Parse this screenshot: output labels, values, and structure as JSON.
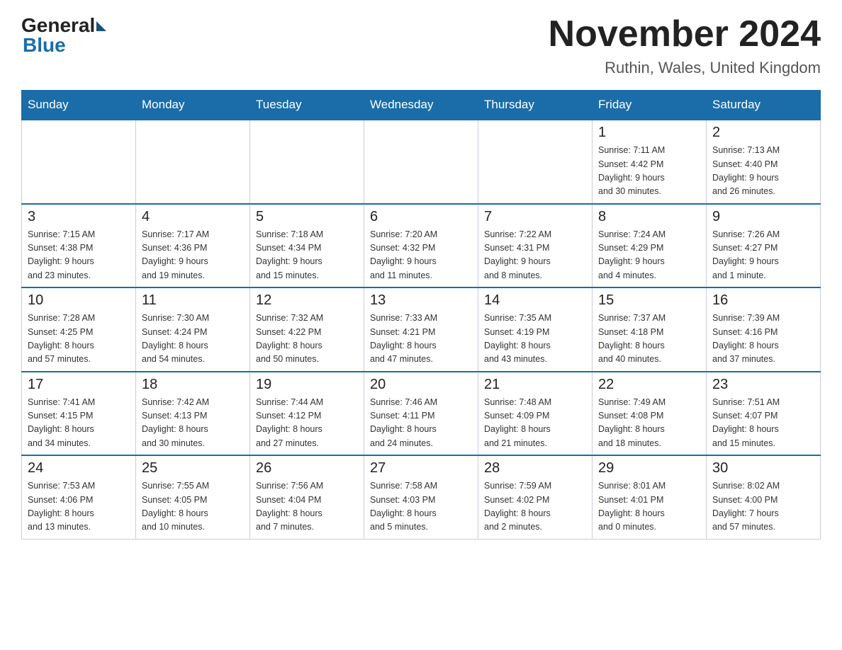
{
  "logo": {
    "general": "General",
    "blue": "Blue"
  },
  "title": "November 2024",
  "subtitle": "Ruthin, Wales, United Kingdom",
  "weekdays": [
    "Sunday",
    "Monday",
    "Tuesday",
    "Wednesday",
    "Thursday",
    "Friday",
    "Saturday"
  ],
  "weeks": [
    [
      {
        "day": "",
        "info": "",
        "empty": true
      },
      {
        "day": "",
        "info": "",
        "empty": true
      },
      {
        "day": "",
        "info": "",
        "empty": true
      },
      {
        "day": "",
        "info": "",
        "empty": true
      },
      {
        "day": "",
        "info": "",
        "empty": true
      },
      {
        "day": "1",
        "info": "Sunrise: 7:11 AM\nSunset: 4:42 PM\nDaylight: 9 hours\nand 30 minutes."
      },
      {
        "day": "2",
        "info": "Sunrise: 7:13 AM\nSunset: 4:40 PM\nDaylight: 9 hours\nand 26 minutes."
      }
    ],
    [
      {
        "day": "3",
        "info": "Sunrise: 7:15 AM\nSunset: 4:38 PM\nDaylight: 9 hours\nand 23 minutes."
      },
      {
        "day": "4",
        "info": "Sunrise: 7:17 AM\nSunset: 4:36 PM\nDaylight: 9 hours\nand 19 minutes."
      },
      {
        "day": "5",
        "info": "Sunrise: 7:18 AM\nSunset: 4:34 PM\nDaylight: 9 hours\nand 15 minutes."
      },
      {
        "day": "6",
        "info": "Sunrise: 7:20 AM\nSunset: 4:32 PM\nDaylight: 9 hours\nand 11 minutes."
      },
      {
        "day": "7",
        "info": "Sunrise: 7:22 AM\nSunset: 4:31 PM\nDaylight: 9 hours\nand 8 minutes."
      },
      {
        "day": "8",
        "info": "Sunrise: 7:24 AM\nSunset: 4:29 PM\nDaylight: 9 hours\nand 4 minutes."
      },
      {
        "day": "9",
        "info": "Sunrise: 7:26 AM\nSunset: 4:27 PM\nDaylight: 9 hours\nand 1 minute."
      }
    ],
    [
      {
        "day": "10",
        "info": "Sunrise: 7:28 AM\nSunset: 4:25 PM\nDaylight: 8 hours\nand 57 minutes."
      },
      {
        "day": "11",
        "info": "Sunrise: 7:30 AM\nSunset: 4:24 PM\nDaylight: 8 hours\nand 54 minutes."
      },
      {
        "day": "12",
        "info": "Sunrise: 7:32 AM\nSunset: 4:22 PM\nDaylight: 8 hours\nand 50 minutes."
      },
      {
        "day": "13",
        "info": "Sunrise: 7:33 AM\nSunset: 4:21 PM\nDaylight: 8 hours\nand 47 minutes."
      },
      {
        "day": "14",
        "info": "Sunrise: 7:35 AM\nSunset: 4:19 PM\nDaylight: 8 hours\nand 43 minutes."
      },
      {
        "day": "15",
        "info": "Sunrise: 7:37 AM\nSunset: 4:18 PM\nDaylight: 8 hours\nand 40 minutes."
      },
      {
        "day": "16",
        "info": "Sunrise: 7:39 AM\nSunset: 4:16 PM\nDaylight: 8 hours\nand 37 minutes."
      }
    ],
    [
      {
        "day": "17",
        "info": "Sunrise: 7:41 AM\nSunset: 4:15 PM\nDaylight: 8 hours\nand 34 minutes."
      },
      {
        "day": "18",
        "info": "Sunrise: 7:42 AM\nSunset: 4:13 PM\nDaylight: 8 hours\nand 30 minutes."
      },
      {
        "day": "19",
        "info": "Sunrise: 7:44 AM\nSunset: 4:12 PM\nDaylight: 8 hours\nand 27 minutes."
      },
      {
        "day": "20",
        "info": "Sunrise: 7:46 AM\nSunset: 4:11 PM\nDaylight: 8 hours\nand 24 minutes."
      },
      {
        "day": "21",
        "info": "Sunrise: 7:48 AM\nSunset: 4:09 PM\nDaylight: 8 hours\nand 21 minutes."
      },
      {
        "day": "22",
        "info": "Sunrise: 7:49 AM\nSunset: 4:08 PM\nDaylight: 8 hours\nand 18 minutes."
      },
      {
        "day": "23",
        "info": "Sunrise: 7:51 AM\nSunset: 4:07 PM\nDaylight: 8 hours\nand 15 minutes."
      }
    ],
    [
      {
        "day": "24",
        "info": "Sunrise: 7:53 AM\nSunset: 4:06 PM\nDaylight: 8 hours\nand 13 minutes."
      },
      {
        "day": "25",
        "info": "Sunrise: 7:55 AM\nSunset: 4:05 PM\nDaylight: 8 hours\nand 10 minutes."
      },
      {
        "day": "26",
        "info": "Sunrise: 7:56 AM\nSunset: 4:04 PM\nDaylight: 8 hours\nand 7 minutes."
      },
      {
        "day": "27",
        "info": "Sunrise: 7:58 AM\nSunset: 4:03 PM\nDaylight: 8 hours\nand 5 minutes."
      },
      {
        "day": "28",
        "info": "Sunrise: 7:59 AM\nSunset: 4:02 PM\nDaylight: 8 hours\nand 2 minutes."
      },
      {
        "day": "29",
        "info": "Sunrise: 8:01 AM\nSunset: 4:01 PM\nDaylight: 8 hours\nand 0 minutes."
      },
      {
        "day": "30",
        "info": "Sunrise: 8:02 AM\nSunset: 4:00 PM\nDaylight: 7 hours\nand 57 minutes."
      }
    ]
  ]
}
